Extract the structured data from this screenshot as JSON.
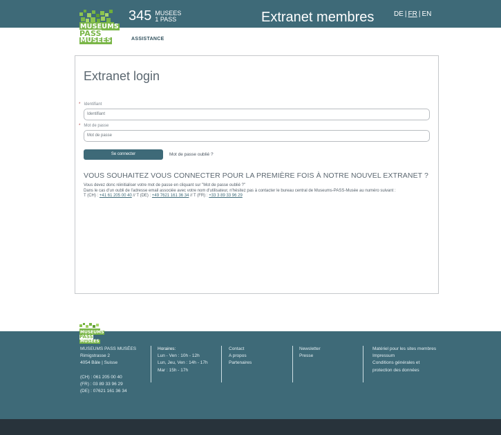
{
  "header": {
    "logo_lines": [
      "MUSEUMS",
      "PASS",
      "MUSEES"
    ],
    "count": "345",
    "count_sub_1": "MUSEES",
    "count_sub_2": "1 PASS",
    "title": "Extranet membres",
    "languages": [
      "DE",
      "FR",
      "EN"
    ],
    "active_language": "FR",
    "assistance": "ASSISTANCE"
  },
  "login": {
    "title": "Extranet login",
    "required_marker": "*",
    "username_label": "Identifiant",
    "username_placeholder": "Identifiant",
    "password_label": "Mot de passe",
    "password_placeholder": "Mot de passe",
    "submit_label": "Se connecter",
    "forgot_link": "Mot de passe oublié ?"
  },
  "info": {
    "heading": "VOUS SOUHAITEZ VOUS CONNECTER POUR LA PREMIÈRE FOIS À NOTRE NOUVEL EXTRANET ?",
    "line1": "Vous devez donc réinitialiser votre mot de passe en cliquant sur \"Mot de passe oublié ?\"",
    "line2": "Dans le cas d'un oubli de l'adresse email associée avec votre nom d'utilisateur, n'hésitez pas à contacter le bureau central de Museums-PASS-Musée au numéro suivant :",
    "phone_ch_label": "T (CH) :",
    "phone_ch": "+41 61 205 00 40",
    "phone_de_label": "// T (DE) :",
    "phone_de": "+49 7621 161 36 34",
    "phone_fr_label": "// T (FR) :",
    "phone_fr": "+33 3 89 33 96 29"
  },
  "footer": {
    "logo_lines": [
      "MUSEUMS",
      "PASS",
      "MUSEES"
    ],
    "address": [
      "MUSEUMS PASS MUSÉES",
      "Rimigstrasse 2",
      "4054 Bâle | Suisse"
    ],
    "phones": [
      "(CH) : 061 205 00 40",
      "(FR) : 03 89 33 96 29",
      "(DE) : 07621 161 36 34"
    ],
    "hours_title": "Horaires:",
    "hours": [
      "Lun - Ven : 10h - 12h",
      "Lun, Jeu, Ven : 14h - 17h",
      "Mar : 15h - 17h"
    ],
    "contact_links": [
      "Contact",
      "A propos",
      "Partenaires"
    ],
    "news_links": [
      "Newsletter",
      "Presse"
    ],
    "member_links": [
      "Matériel pour les sites membres",
      "Impressum",
      "Conditions générales et protection des données"
    ]
  },
  "colors": {
    "brand": "#3e6a78",
    "logo_green": "#7ab648",
    "bottom_bar": "#28333b"
  }
}
